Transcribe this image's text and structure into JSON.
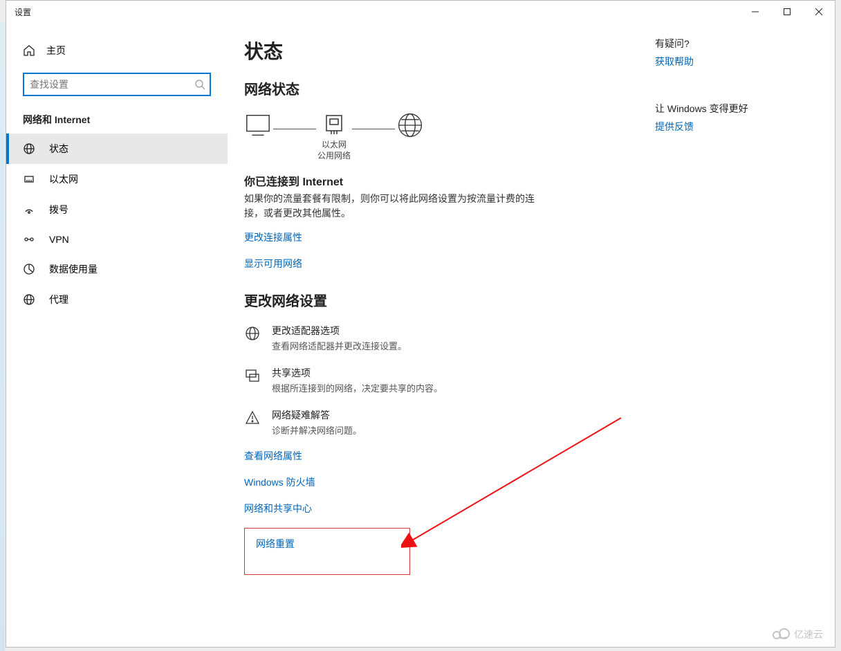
{
  "titlebar": {
    "title": "设置"
  },
  "sidebar": {
    "home_label": "主页",
    "search_placeholder": "查找设置",
    "group_title": "网络和 Internet",
    "items": [
      {
        "label": "状态"
      },
      {
        "label": "以太网"
      },
      {
        "label": "拨号"
      },
      {
        "label": "VPN"
      },
      {
        "label": "数据使用量"
      },
      {
        "label": "代理"
      }
    ]
  },
  "main": {
    "page_title": "状态",
    "network_status_heading": "网络状态",
    "diagram": {
      "mid_line1": "以太网",
      "mid_line2": "公用网络"
    },
    "connected_heading": "你已连接到 Internet",
    "connected_text": "如果你的流量套餐有限制，则你可以将此网络设置为按流量计费的连接，或者更改其他属性。",
    "change_props_link": "更改连接属性",
    "show_networks_link": "显示可用网络",
    "change_settings_heading": "更改网络设置",
    "opts": [
      {
        "t1": "更改适配器选项",
        "t2": "查看网络适配器并更改连接设置。"
      },
      {
        "t1": "共享选项",
        "t2": "根据所连接到的网络，决定要共享的内容。"
      },
      {
        "t1": "网络疑难解答",
        "t2": "诊断并解决网络问题。"
      }
    ],
    "links": [
      "查看网络属性",
      "Windows 防火墙",
      "网络和共享中心"
    ],
    "reset_link": "网络重置"
  },
  "side": {
    "help_heading": "有疑问?",
    "help_link": "获取帮助",
    "improve_heading": "让 Windows 变得更好",
    "feedback_link": "提供反馈"
  },
  "watermark_text": "亿速云"
}
